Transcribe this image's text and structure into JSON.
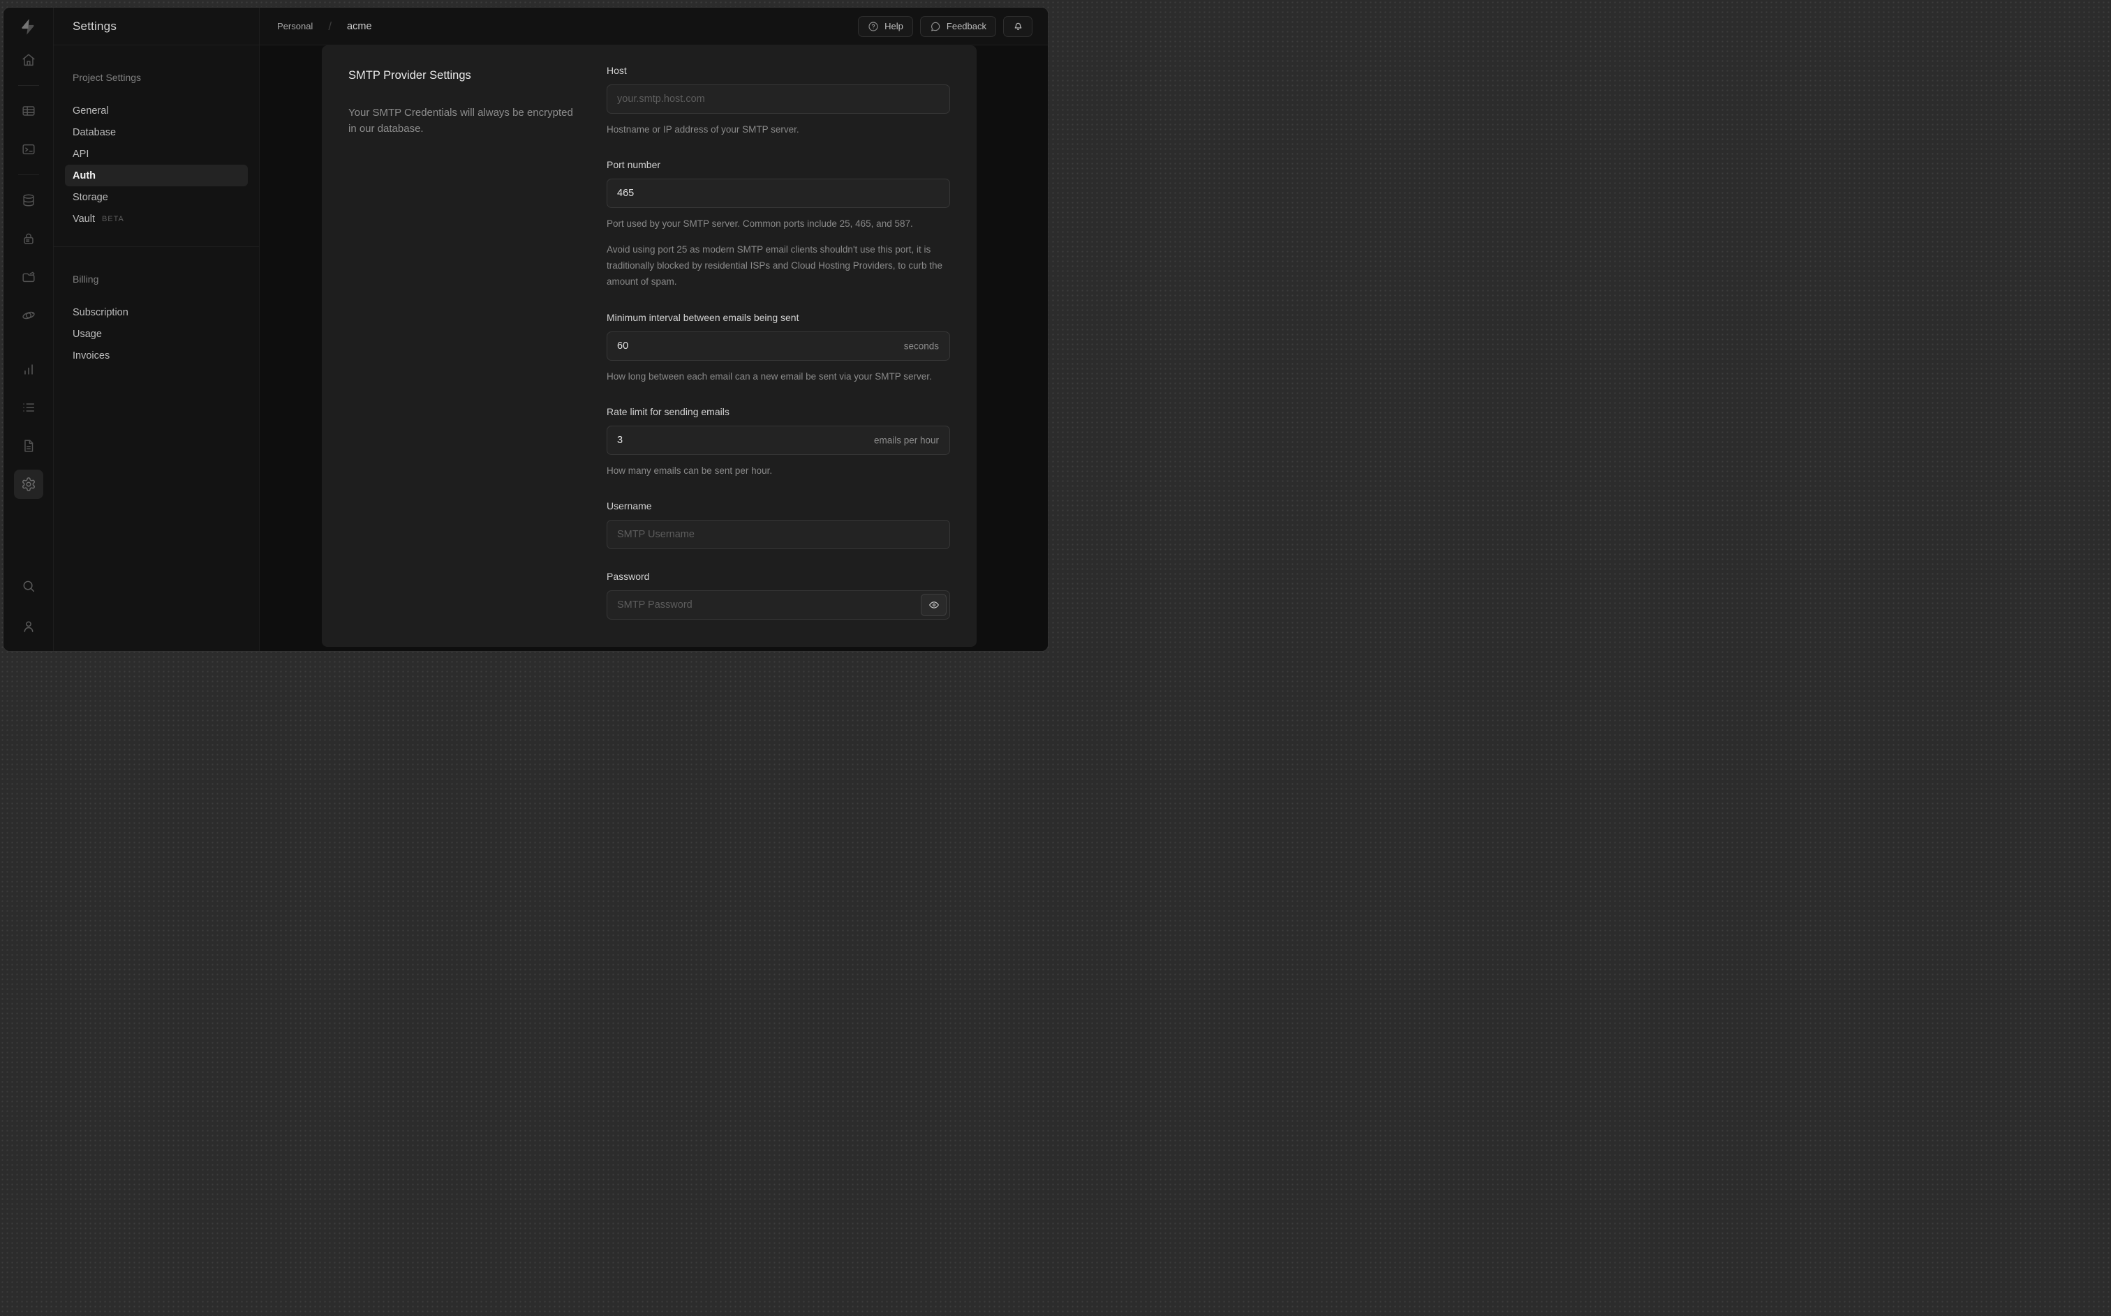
{
  "rail": {
    "icons": [
      "home",
      "table-editor",
      "sql-editor",
      "database",
      "auth",
      "storage",
      "edge-functions",
      "reports",
      "logs",
      "api-docs",
      "settings",
      "search",
      "user"
    ],
    "active_icon": "settings"
  },
  "sidebar": {
    "title": "Settings",
    "sections": [
      {
        "heading": "Project Settings",
        "items": [
          {
            "label": "General"
          },
          {
            "label": "Database"
          },
          {
            "label": "API"
          },
          {
            "label": "Auth",
            "active": true
          },
          {
            "label": "Storage"
          },
          {
            "label": "Vault",
            "badge": "BETA"
          }
        ]
      },
      {
        "heading": "Billing",
        "items": [
          {
            "label": "Subscription"
          },
          {
            "label": "Usage"
          },
          {
            "label": "Invoices"
          }
        ]
      }
    ]
  },
  "header": {
    "breadcrumb": {
      "org": "Personal",
      "separator": "/",
      "project": "acme"
    },
    "buttons": {
      "help": "Help",
      "feedback": "Feedback",
      "bell_icon": "bell"
    }
  },
  "panel": {
    "title": "SMTP Provider Settings",
    "description": "Your SMTP Credentials will always be encrypted in our database.",
    "fields": {
      "host": {
        "label": "Host",
        "placeholder": "your.smtp.host.com",
        "helper": "Hostname or IP address of your SMTP server."
      },
      "port": {
        "label": "Port number",
        "value": "465",
        "helper": "Port used by your SMTP server. Common ports include 25, 465, and 587.",
        "helper2": "Avoid using port 25 as modern SMTP email clients shouldn't use this port, it is traditionally blocked by residential ISPs and Cloud Hosting Providers, to curb the amount of spam."
      },
      "interval": {
        "label": "Minimum interval between emails being sent",
        "value": "60",
        "suffix": "seconds",
        "helper": "How long between each email can a new email be sent via your SMTP server."
      },
      "rate": {
        "label": "Rate limit for sending emails",
        "value": "3",
        "suffix": "emails per hour",
        "helper": "How many emails can be sent per hour."
      },
      "username": {
        "label": "Username",
        "placeholder": "SMTP Username"
      },
      "password": {
        "label": "Password",
        "placeholder": "SMTP Password"
      }
    }
  },
  "colors": {
    "desktop_background": "#2c2c2c",
    "window_background": "#111111",
    "panel_background": "#1e1e1e",
    "input_background": "#232323",
    "text_primary": "#ececec",
    "text_muted": "#8a8a8a"
  }
}
